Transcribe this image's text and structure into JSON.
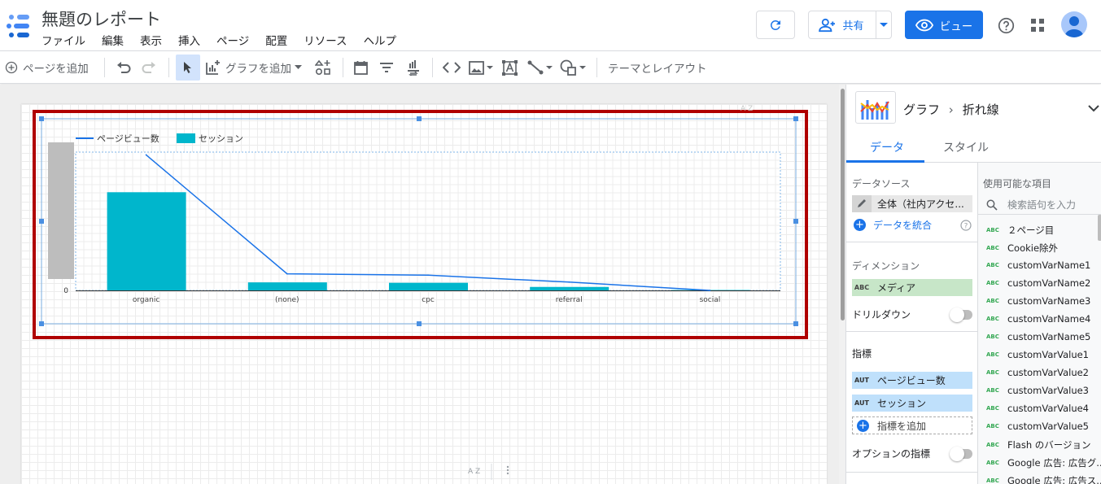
{
  "header": {
    "title": "無題のレポート",
    "menu": [
      "ファイル",
      "編集",
      "表示",
      "挿入",
      "ページ",
      "配置",
      "リソース",
      "ヘルプ"
    ],
    "share_label": "共有",
    "view_label": "ビュー"
  },
  "toolbar": {
    "add_page": "ページを追加",
    "add_chart": "グラフを追加",
    "theme_layout": "テーマとレイアウト"
  },
  "chart_data": {
    "type": "bar",
    "categories": [
      "organic",
      "(none)",
      "cpc",
      "referral",
      "social"
    ],
    "series": [
      {
        "name": "ページビュー数",
        "type": "line",
        "values": [
          98,
          12,
          11,
          6,
          0
        ]
      },
      {
        "name": "セッション",
        "type": "bar",
        "values": [
          71,
          5.8,
          5.5,
          2.5,
          0.3
        ]
      }
    ],
    "ylim": [
      0,
      100
    ],
    "y_tick_label": "0",
    "grid": true,
    "legend_position": "top-left",
    "colors": {
      "line": "#1a73e8",
      "bar": "#00b6cc"
    }
  },
  "panel": {
    "breadcrumb_chart": "グラフ",
    "breadcrumb_arrow": "›",
    "breadcrumb_type": "折れ線",
    "tab_data": "データ",
    "tab_style": "スタイル",
    "datasource_title": "データソース",
    "datasource_value": "全体（社内アクセ...",
    "blend_label": "データを統合",
    "dimension_title": "ディメンション",
    "dimension_value": "メディア",
    "dimension_tag": "ABC",
    "drilldown_label": "ドリルダウン",
    "metrics_title": "指標",
    "metrics": [
      {
        "tag": "AUT",
        "label": "ページビュー数"
      },
      {
        "tag": "AUT",
        "label": "セッション"
      }
    ],
    "add_metric_label": "指標を追加",
    "optional_metrics_label": "オプションの指標",
    "available_title": "使用可能な項目",
    "search_placeholder": "検索語句を入力",
    "field_tag": "ABC",
    "fields": [
      "２ページ目",
      "Cookie除外",
      "customVarName1",
      "customVarName2",
      "customVarName3",
      "customVarName4",
      "customVarName5",
      "customVarValue1",
      "customVarValue2",
      "customVarValue3",
      "customVarValue4",
      "customVarValue5",
      "Flash のバージョン",
      "Google 広告: 広告グ...",
      "Google 広告: 広告ス..."
    ]
  }
}
